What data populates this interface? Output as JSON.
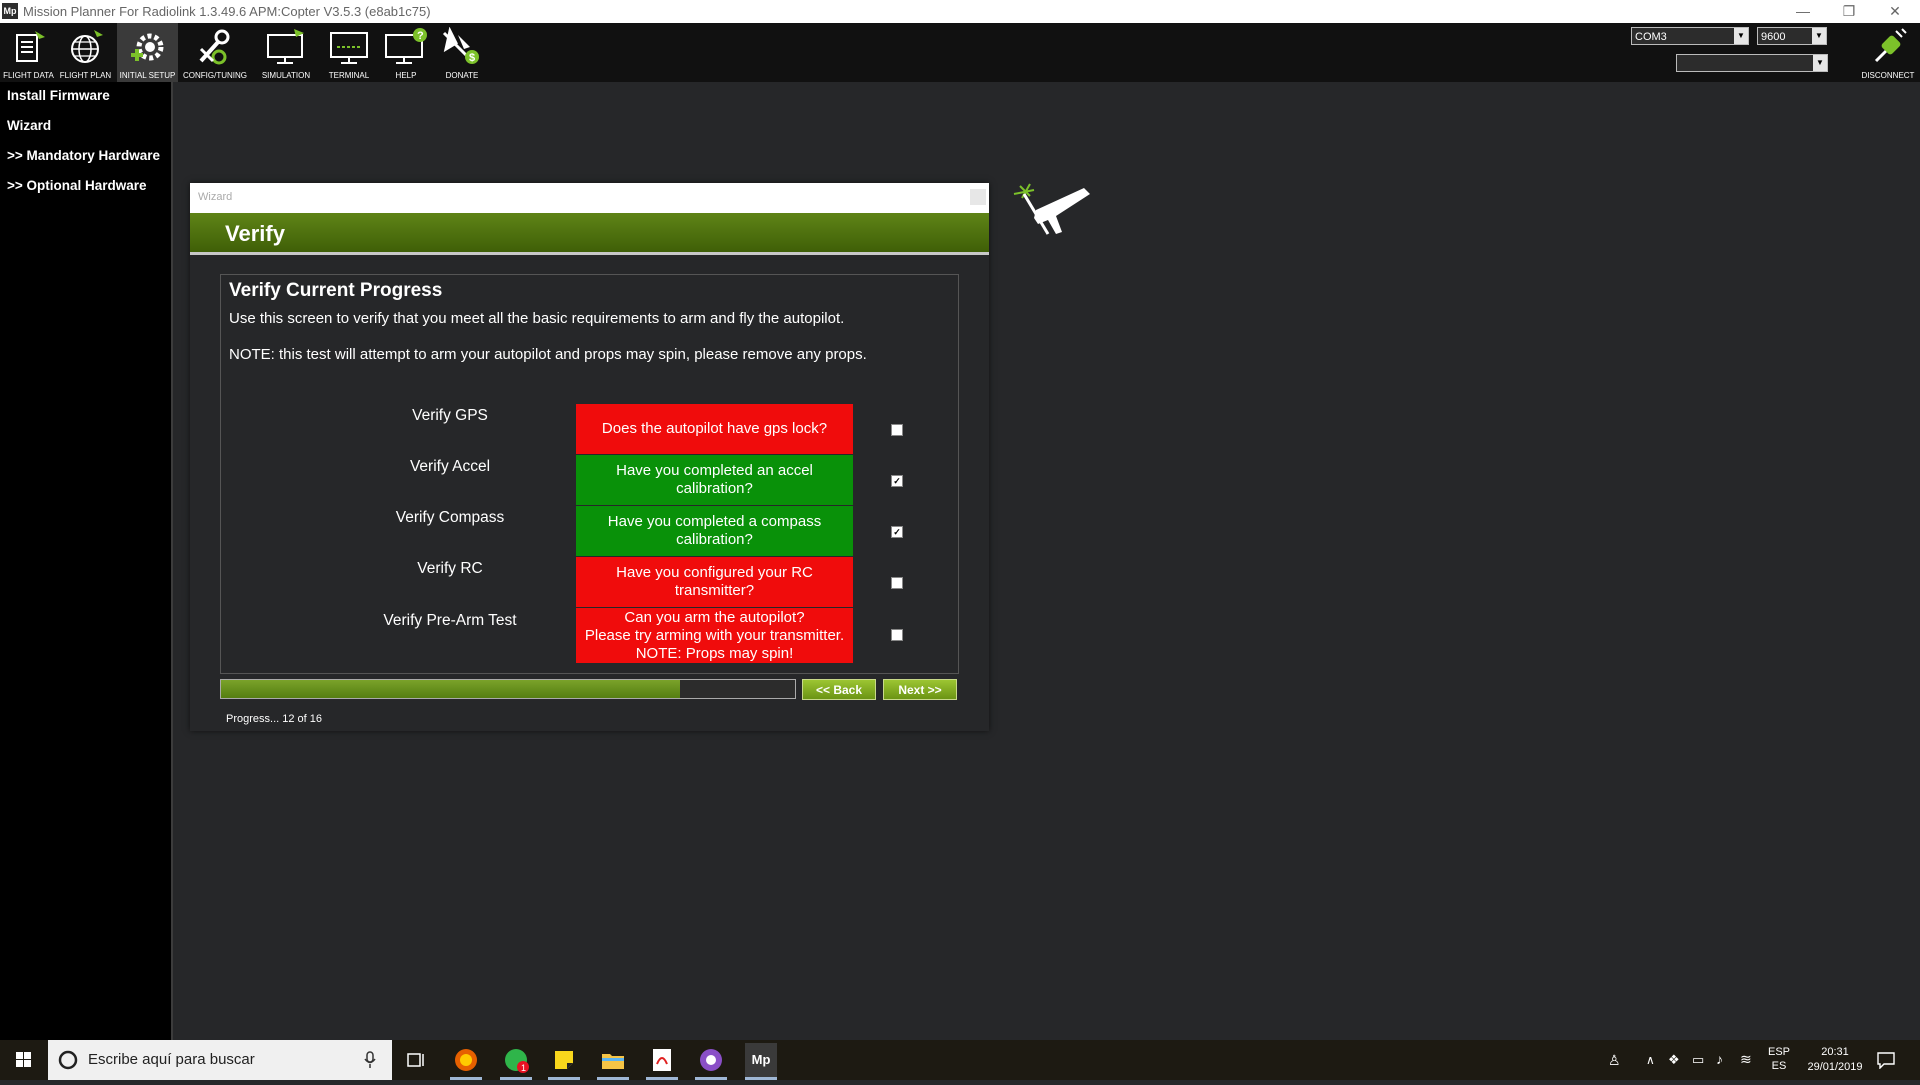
{
  "window": {
    "title": "Mission Planner For Radiolink 1.3.49.6 APM:Copter V3.5.3 (e8ab1c75)",
    "app_icon": "Mp",
    "minimize": "—",
    "restore": "❐",
    "close": "✕"
  },
  "toolbar": {
    "items": [
      {
        "label": "FLIGHT DATA",
        "icon": "flight-data-icon"
      },
      {
        "label": "FLIGHT PLAN",
        "icon": "globe-icon"
      },
      {
        "label": "INITIAL SETUP",
        "icon": "initial-setup-icon"
      },
      {
        "label": "CONFIG/TUNING",
        "icon": "wrench-gear-icon"
      },
      {
        "label": "SIMULATION",
        "icon": "simulation-monitor-icon"
      },
      {
        "label": "TERMINAL",
        "icon": "terminal-monitor-icon"
      },
      {
        "label": "HELP",
        "icon": "help-monitor-icon"
      },
      {
        "label": "DONATE",
        "icon": "donate-plane-icon"
      }
    ],
    "port": "COM3",
    "baud": "9600",
    "profile": "",
    "disconnect_label": "DISCONNECT",
    "disconnect_icon": "plug-icon"
  },
  "sidebar": {
    "items": [
      {
        "label": "Install Firmware"
      },
      {
        "label": "Wizard"
      },
      {
        "label": ">> Mandatory Hardware"
      },
      {
        "label": ">> Optional Hardware"
      }
    ]
  },
  "wizard": {
    "window_title": "Wizard",
    "header": "Verify",
    "content_title": "Verify Current Progress",
    "description": "Use this screen to verify that you meet all the basic requirements to arm and fly the autopilot.",
    "note": "NOTE: this test will attempt to arm your autopilot and props may spin, please remove any props.",
    "checks": [
      {
        "label": "Verify GPS",
        "question": "Does the autopilot have gps lock?",
        "status": "red",
        "checked": false
      },
      {
        "label": "Verify Accel",
        "question": "Have you completed an accel calibration?",
        "status": "green",
        "checked": true
      },
      {
        "label": "Verify Compass",
        "question": "Have you completed a compass calibration?",
        "status": "green",
        "checked": true
      },
      {
        "label": "Verify RC",
        "question": "Have you configured your RC transmitter?",
        "status": "red",
        "checked": false
      },
      {
        "label": "Verify Pre-Arm Test",
        "question": "Can you arm the autopilot?\nPlease try arming with your transmitter.\nNOTE: Props may spin!",
        "status": "red",
        "checked": false
      }
    ],
    "progress_fraction": 0.8,
    "back_label": "<< Back",
    "next_label": "Next >>",
    "progress_text": "Progress... 12 of 16"
  },
  "taskbar": {
    "search_placeholder": "Escribe aquí para buscar",
    "notification_badge": "1",
    "language": "ESP",
    "layout": "ES",
    "time": "20:31",
    "date": "29/01/2019"
  },
  "colors": {
    "accent_green": "#5f8417",
    "status_red": "#f00c0c",
    "status_green": "#099109"
  }
}
